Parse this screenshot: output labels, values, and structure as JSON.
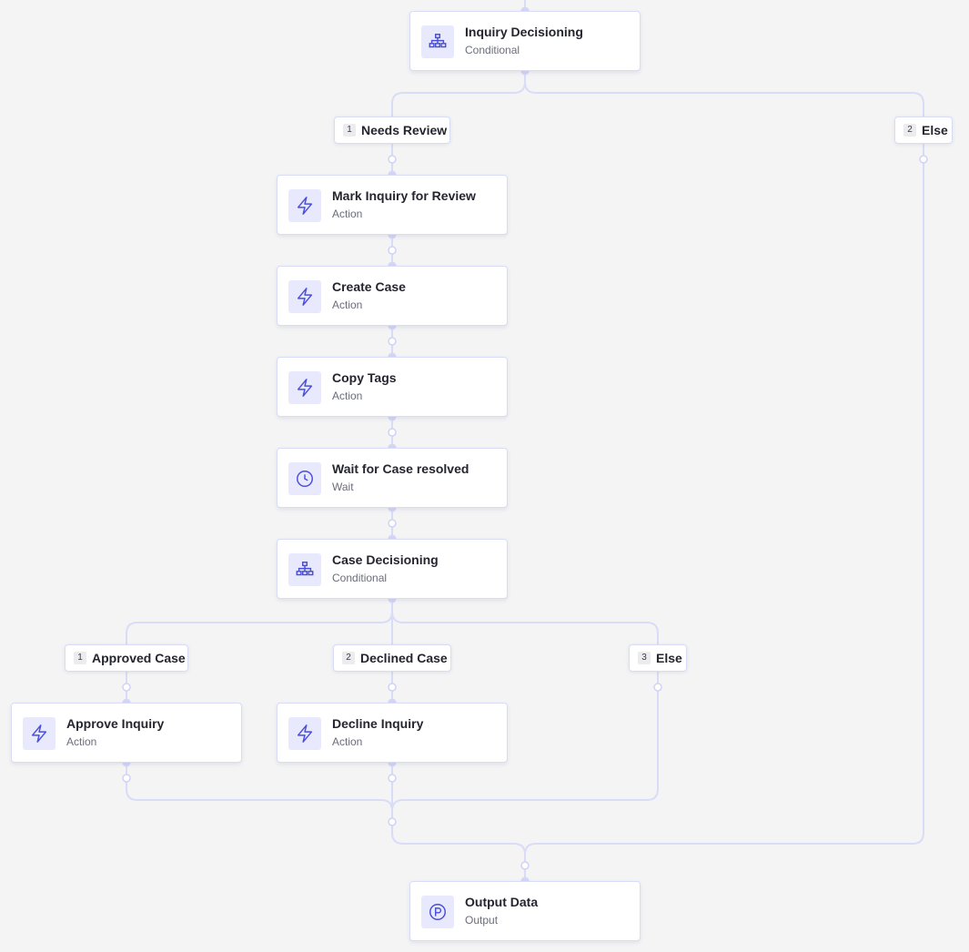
{
  "nodes": {
    "inquiry_decisioning": {
      "title": "Inquiry Decisioning",
      "type": "Conditional",
      "icon": "hierarchy-icon"
    },
    "mark_inquiry_review": {
      "title": "Mark Inquiry for Review",
      "type": "Action",
      "icon": "lightning-icon"
    },
    "create_case": {
      "title": "Create Case",
      "type": "Action",
      "icon": "lightning-icon"
    },
    "copy_tags": {
      "title": "Copy Tags",
      "type": "Action",
      "icon": "lightning-icon"
    },
    "wait_case_resolved": {
      "title": "Wait for Case resolved",
      "type": "Wait",
      "icon": "clock-icon"
    },
    "case_decisioning": {
      "title": "Case Decisioning",
      "type": "Conditional",
      "icon": "hierarchy-icon"
    },
    "approve_inquiry": {
      "title": "Approve Inquiry",
      "type": "Action",
      "icon": "lightning-icon"
    },
    "decline_inquiry": {
      "title": "Decline Inquiry",
      "type": "Action",
      "icon": "lightning-icon"
    },
    "output_data": {
      "title": "Output Data",
      "type": "Output",
      "icon": "output-p-icon"
    }
  },
  "branches": {
    "needs_review": {
      "num": "1",
      "label": "Needs Review"
    },
    "else_top": {
      "num": "2",
      "label": "Else"
    },
    "approved_case": {
      "num": "1",
      "label": "Approved Case"
    },
    "declined_case": {
      "num": "2",
      "label": "Declined Case"
    },
    "else_case": {
      "num": "3",
      "label": "Else"
    }
  },
  "colors": {
    "canvas_bg": "#f4f4f5",
    "connector": "#d9dcf7",
    "icon_bg": "#e8e9fd",
    "icon_stroke": "#4a4fd9"
  }
}
